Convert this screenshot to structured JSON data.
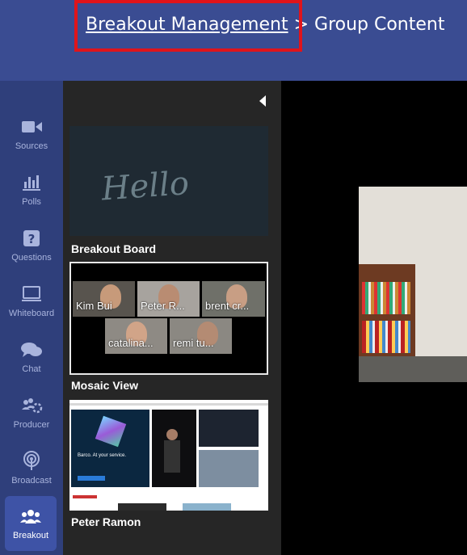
{
  "header": {
    "breadcrumb_link": "Breakout Management",
    "breadcrumb_sep": ">",
    "breadcrumb_current": "Group Content"
  },
  "sidebar": {
    "items": [
      {
        "label": "Sources",
        "icon": "video-camera-icon"
      },
      {
        "label": "Polls",
        "icon": "bar-chart-icon"
      },
      {
        "label": "Questions",
        "icon": "question-icon"
      },
      {
        "label": "Whiteboard",
        "icon": "whiteboard-icon"
      },
      {
        "label": "Chat",
        "icon": "chat-icon"
      },
      {
        "label": "Producer",
        "icon": "producer-icon"
      },
      {
        "label": "Broadcast",
        "icon": "broadcast-icon"
      },
      {
        "label": "Breakout",
        "icon": "group-icon"
      }
    ],
    "active": "Breakout"
  },
  "panel": {
    "board": {
      "label": "Breakout Board",
      "handwriting": "Hello"
    },
    "mosaic": {
      "label": "Mosaic View",
      "participants": [
        "Kim Bui",
        "Peter R...",
        "brent cr...",
        "catalina...",
        "remi tu..."
      ]
    },
    "screen": {
      "label": "Peter Ramon",
      "tagline": "Barco. At your service."
    }
  },
  "colors": {
    "sidebar_bg": "#2f3f7b",
    "header_bg": "#3a4c92",
    "active_item_bg": "#3e53a6",
    "highlight_border": "#e0141b",
    "panel_bg": "#262626"
  }
}
